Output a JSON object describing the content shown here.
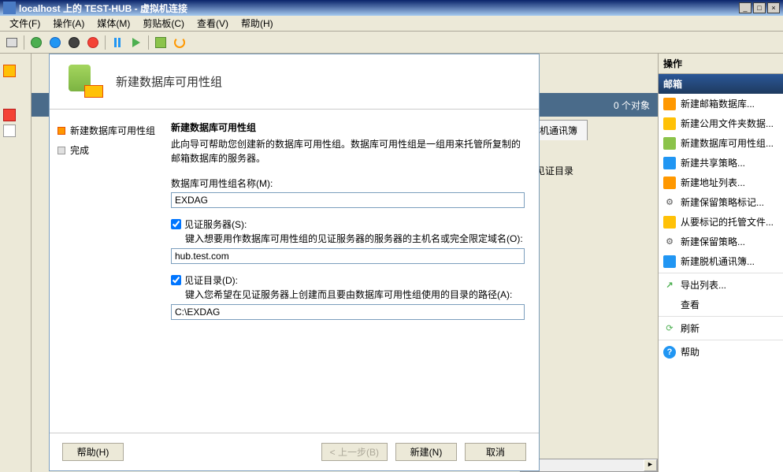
{
  "titlebar": {
    "text": "localhost 上的 TEST-HUB - 虚拟机连接"
  },
  "menubar": {
    "file": "文件(F)",
    "action": "操作(A)",
    "media": "媒体(M)",
    "clipboard": "剪贴板(C)",
    "view": "查看(V)",
    "help": "帮助(H)"
  },
  "bg": {
    "object_count": "0 个对象",
    "tab_offline": "脱机通讯簿",
    "witness_label": "见证目录"
  },
  "dialog": {
    "title": "新建数据库可用性组",
    "nav_step1": "新建数据库可用性组",
    "nav_step2": "完成",
    "section_title": "新建数据库可用性组",
    "section_desc": "此向导可帮助您创建新的数据库可用性组。数据库可用性组是一组用来托管所复制的邮箱数据库的服务器。",
    "name_label": "数据库可用性组名称(M):",
    "name_value": "EXDAG",
    "witness_server_label": "见证服务器(S):",
    "witness_server_hint": "键入想要用作数据库可用性组的见证服务器的服务器的主机名或完全限定域名(O):",
    "witness_server_value": "hub.test.com",
    "witness_dir_label": "见证目录(D):",
    "witness_dir_hint": "键入您希望在见证服务器上创建而且要由数据库可用性组使用的目录的路径(A):",
    "witness_dir_value": "C:\\EXDAG",
    "witness_dir_placeholder": "",
    "btn_help": "帮助(H)",
    "btn_back": "< 上一步(B)",
    "btn_create": "新建(N)",
    "btn_cancel": "取消"
  },
  "actions": {
    "header": "操作",
    "section": "邮箱",
    "items": [
      "新建邮箱数据库...",
      "新建公用文件夹数据...",
      "新建数据库可用性组...",
      "新建共享策略...",
      "新建地址列表...",
      "新建保留策略标记...",
      "从要标记的托管文件...",
      "新建保留策略...",
      "新建脱机通讯簿...",
      "导出列表...",
      "查看",
      "刷新",
      "帮助"
    ]
  }
}
